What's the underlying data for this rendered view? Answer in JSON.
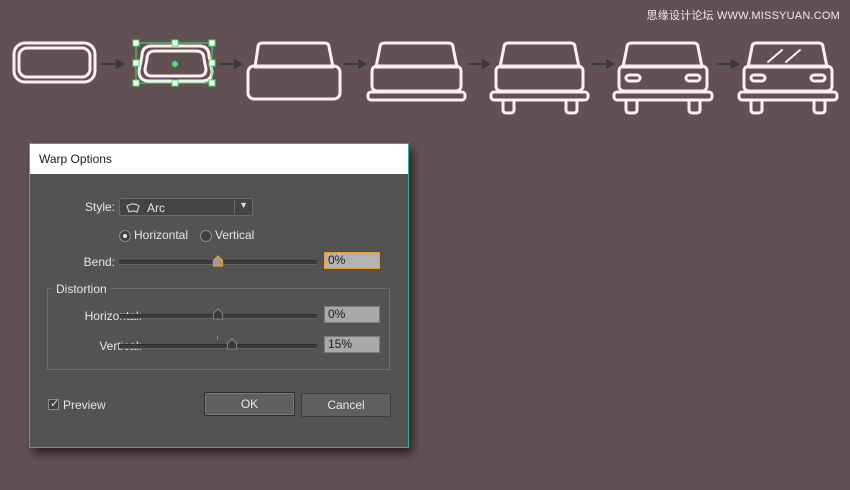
{
  "watermark": "思缘设计论坛 WWW.MISSYUAN.COM",
  "colors": {
    "background": "#625154",
    "car_outline": "#fbeff2",
    "selection": "#4be36a",
    "dialog_border": "#3fa89a",
    "focus": "#ee9d2a"
  },
  "steps": [
    {
      "name": "rounded-rectangle",
      "selected": false
    },
    {
      "name": "warped-rectangle",
      "selected": true
    },
    {
      "name": "car-body",
      "selected": false
    },
    {
      "name": "car-body-bumper",
      "selected": false
    },
    {
      "name": "car-with-wheels",
      "selected": false
    },
    {
      "name": "car-with-lights",
      "selected": false
    },
    {
      "name": "car-with-glare",
      "selected": false
    }
  ],
  "dialog": {
    "title": "Warp Options",
    "style_label": "Style:",
    "style_value": "Arc",
    "style_icon": "arc-icon",
    "orientation": {
      "horizontal_label": "Horizontal",
      "vertical_label": "Vertical",
      "selected": "Horizontal"
    },
    "bend": {
      "label": "Bend:",
      "value": "0%",
      "fraction": 0.5
    },
    "distortion": {
      "title": "Distortion",
      "horizontal": {
        "label": "Horizontal:",
        "value": "0%",
        "fraction": 0.5
      },
      "vertical": {
        "label": "Vertical:",
        "value": "15%",
        "fraction": 0.575
      }
    },
    "preview": {
      "label": "Preview",
      "checked": true
    },
    "ok_label": "OK",
    "cancel_label": "Cancel"
  }
}
